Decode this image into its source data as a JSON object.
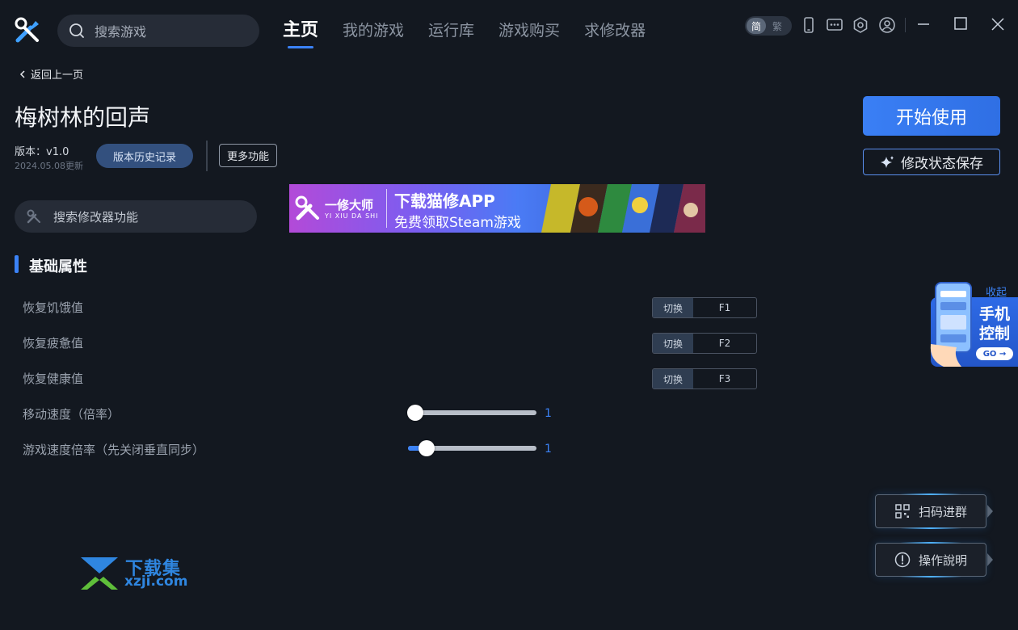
{
  "header": {
    "search_placeholder": "搜索游戏",
    "tabs": [
      {
        "label": "主页",
        "active": true
      },
      {
        "label": "我的游戏",
        "active": false
      },
      {
        "label": "运行库",
        "active": false
      },
      {
        "label": "游戏购买",
        "active": false
      },
      {
        "label": "求修改器",
        "active": false
      }
    ],
    "lang_simplified": "简",
    "lang_traditional": "繁",
    "icons": [
      "phone-icon",
      "chat-icon",
      "settings-icon",
      "user-icon",
      "minimize-icon",
      "maximize-icon",
      "close-icon"
    ]
  },
  "page": {
    "back_label": "返回上一页",
    "game_title": "梅树林的回声",
    "version": "版本：v1.0",
    "update_date": "2024.05.08更新",
    "history_button": "版本历史记录",
    "more_button": "更多功能",
    "start_button": "开始使用",
    "save_state_button": "修改状态保存"
  },
  "banner": {
    "brand": "一修大师",
    "brand_sub": "YI XIU DA SHI",
    "headline": "下载猫修APP",
    "subline": "免费领取Steam游戏"
  },
  "features": {
    "search_placeholder": "搜索修改器功能",
    "section_title": "基础属性",
    "toggles": [
      {
        "label": "恢复饥饿值",
        "action": "切换",
        "key": "F1"
      },
      {
        "label": "恢复疲惫值",
        "action": "切换",
        "key": "F2"
      },
      {
        "label": "恢复健康值",
        "action": "切换",
        "key": "F3"
      }
    ],
    "sliders": [
      {
        "label": "移动速度（倍率）",
        "value": "1",
        "level": 0.0
      },
      {
        "label": "游戏速度倍率（先关闭垂直同步）",
        "value": "1",
        "level": 0.1
      }
    ]
  },
  "side_widget": {
    "collapse_label": "收起",
    "line1": "手机",
    "line2": "控制",
    "go_label": "GO →"
  },
  "side_buttons": {
    "qr_label": "扫码进群",
    "help_label": "操作說明"
  },
  "watermark": {
    "title": "下载集",
    "url": "xzji.com"
  },
  "colors": {
    "background": "#131820",
    "accent": "#3b82f6",
    "panel": "#262c37"
  }
}
